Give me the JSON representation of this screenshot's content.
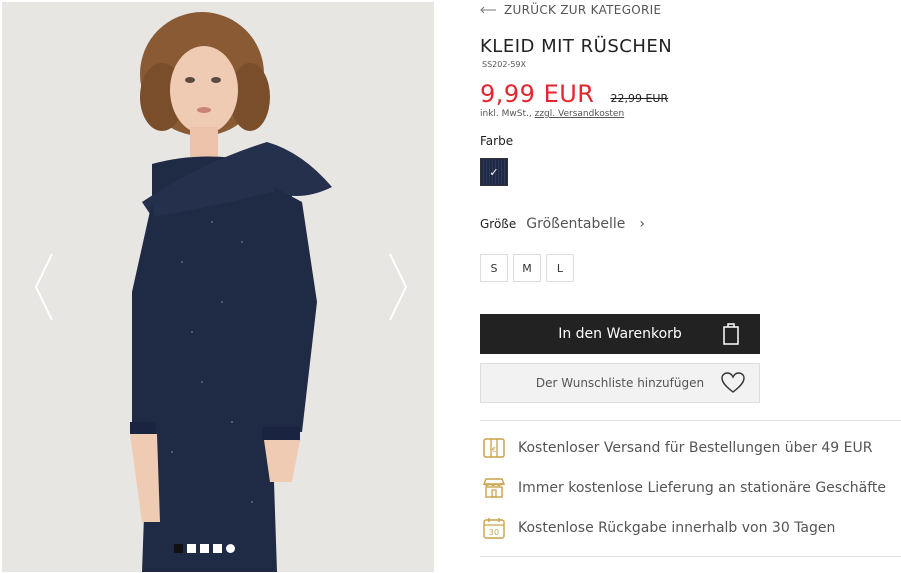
{
  "back_link": "ZURÜCK ZUR KATEGORIE",
  "product": {
    "title": "KLEID MIT RÜSCHEN",
    "sku": "SS202-59X",
    "price": "9,99 EUR",
    "old_price": "22,99 EUR",
    "tax_text": "inkl. MwSt.,",
    "shipping_link": "zzgl. Versandkosten"
  },
  "color": {
    "label": "Farbe",
    "selected_swatch": "navy",
    "swatch_color": "#1e2a44"
  },
  "size": {
    "label": "Größe",
    "chart_link": "Größentabelle",
    "options": [
      "S",
      "M",
      "L"
    ]
  },
  "buttons": {
    "add_to_cart": "In den Warenkorb",
    "wishlist": "Der Wunschliste hinzufügen"
  },
  "benefits": [
    {
      "icon": "free-shipping-box-icon",
      "text": "Kostenloser Versand für Bestellungen über 49 EUR"
    },
    {
      "icon": "store-icon",
      "text": "Immer kostenlose Lieferung an stationäre Geschäfte"
    },
    {
      "icon": "calendar-30-icon",
      "text": "Kostenlose Rückgabe innerhalb von 30 Tagen"
    }
  ],
  "gallery": {
    "image_count": 5,
    "active_index": 0
  },
  "colors": {
    "price_red": "#e3262f",
    "button_dark": "#222222",
    "icon_gold": "#c9a24a"
  }
}
